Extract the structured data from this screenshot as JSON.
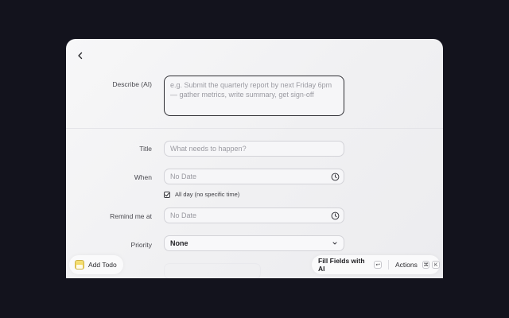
{
  "form": {
    "describe": {
      "label": "Describe (AI)",
      "placeholder": "e.g. Submit the quarterly report by next Friday 6pm — gather metrics, write summary, get sign-off"
    },
    "title": {
      "label": "Title",
      "placeholder": "What needs to happen?"
    },
    "when": {
      "label": "When",
      "placeholder": "No Date"
    },
    "all_day": {
      "label": "All day (no specific time)",
      "checked": true
    },
    "remind": {
      "label": "Remind me at",
      "placeholder": "No Date"
    },
    "priority": {
      "label": "Priority",
      "value": "None"
    }
  },
  "bottom_bar": {
    "app_name": "Add Todo",
    "fill_ai_label": "Fill Fields with AI",
    "enter_key": "↩",
    "actions_label": "Actions",
    "cmd_key": "⌘",
    "k_key": "K"
  },
  "colors": {
    "background": "#13131d",
    "panel": "#f3f3f5",
    "focus_border": "#2e2e33"
  },
  "icons": {
    "back": "chevron-left-icon",
    "clock": "clock-icon",
    "check": "checkmark-icon",
    "select": "chevron-down-icon",
    "app": "notes-app-icon"
  }
}
